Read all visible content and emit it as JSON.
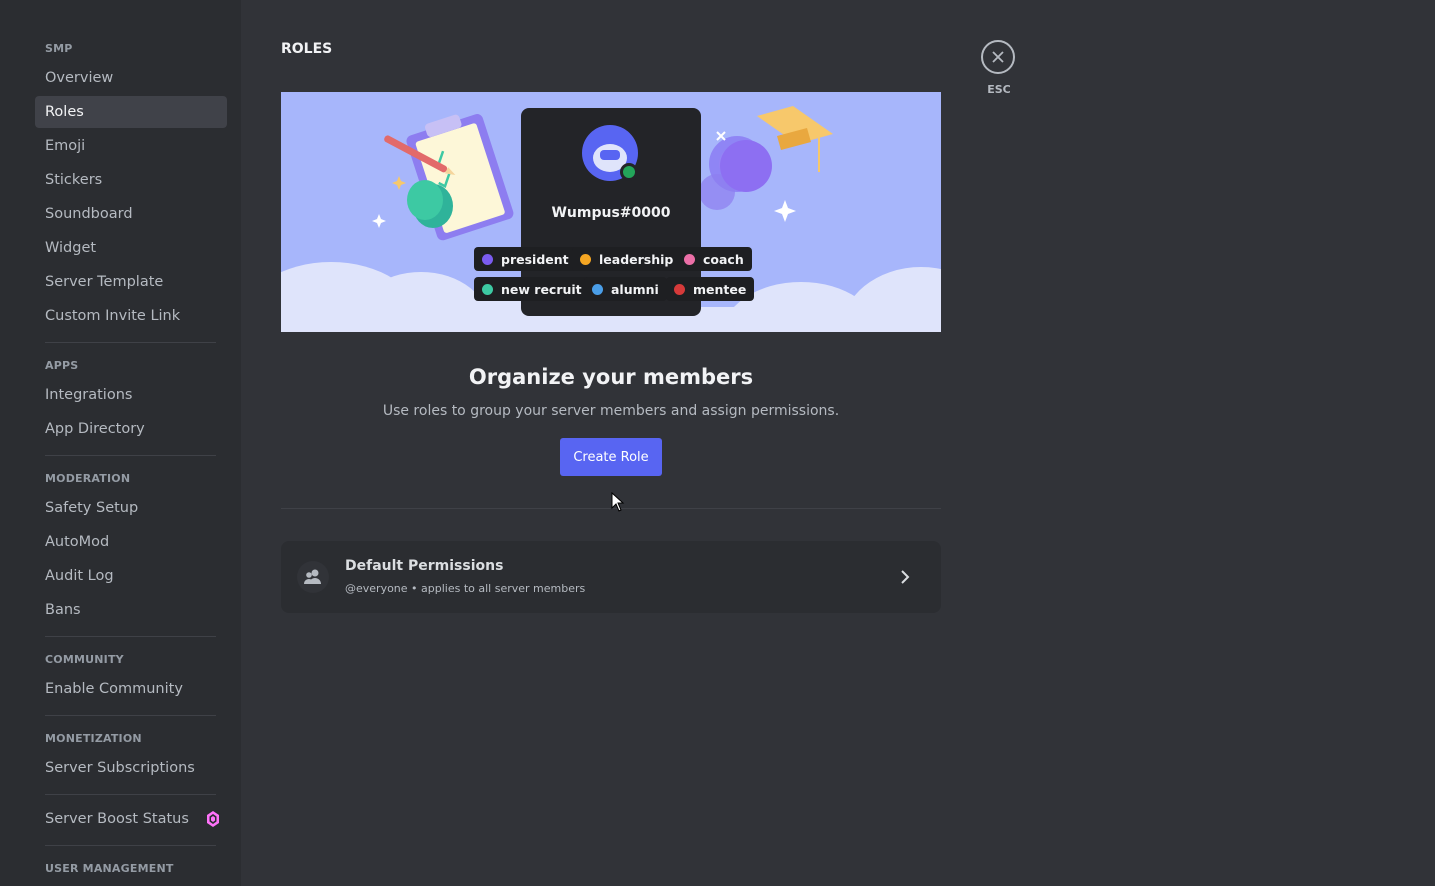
{
  "sidebar": {
    "sections": [
      {
        "header": "SMP",
        "items": [
          "Overview",
          "Roles",
          "Emoji",
          "Stickers",
          "Soundboard",
          "Widget",
          "Server Template",
          "Custom Invite Link"
        ]
      },
      {
        "header": "APPS",
        "items": [
          "Integrations",
          "App Directory"
        ]
      },
      {
        "header": "MODERATION",
        "items": [
          "Safety Setup",
          "AutoMod",
          "Audit Log",
          "Bans"
        ]
      },
      {
        "header": "COMMUNITY",
        "items": [
          "Enable Community"
        ]
      },
      {
        "header": "MONETIZATION",
        "items": [
          "Server Subscriptions"
        ]
      },
      {
        "header": "",
        "items": [
          "Server Boost Status"
        ]
      },
      {
        "header": "USER MANAGEMENT",
        "items": []
      }
    ],
    "active_item": "Roles"
  },
  "main": {
    "page_title": "ROLES",
    "illustration": {
      "username": "Wumpus#0000",
      "roles": [
        {
          "name": "president",
          "color": "#7b5cf0"
        },
        {
          "name": "leadership",
          "color": "#f5a623"
        },
        {
          "name": "coach",
          "color": "#eb6fa7"
        },
        {
          "name": "new recruit",
          "color": "#3dc9a3"
        },
        {
          "name": "alumni",
          "color": "#4a9ee8"
        },
        {
          "name": "mentee",
          "color": "#d63a3a"
        }
      ]
    },
    "heading": "Organize your members",
    "subtext": "Use roles to group your server members and assign permissions.",
    "create_button": "Create Role",
    "default_permissions": {
      "title": "Default Permissions",
      "subtitle": "@everyone • applies to all server members"
    }
  },
  "close": {
    "label": "ESC"
  },
  "colors": {
    "accent": "#5865f2",
    "background": "#313338",
    "sidebar": "#2b2d31",
    "banner": "#a7b6fb",
    "status_online": "#23a55a",
    "boost_gem": "#ff73fa"
  }
}
